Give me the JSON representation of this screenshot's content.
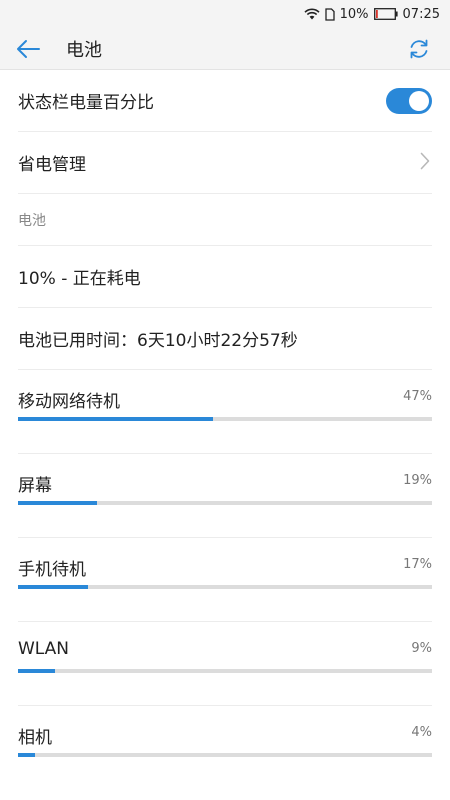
{
  "statusbar": {
    "battery_percent": "10%",
    "time": "07:25",
    "battery_level": 0.1
  },
  "appbar": {
    "title": "电池"
  },
  "settings": {
    "percent_toggle_label": "状态栏电量百分比",
    "percent_toggle_on": true,
    "power_saving_label": "省电管理",
    "battery_section_header": "电池",
    "battery_status": "10% - 正在耗电",
    "battery_usage_time": "电池已用时间：6天10小时22分57秒"
  },
  "usage": [
    {
      "name": "移动网络待机",
      "percent_label": "47%",
      "value": 47
    },
    {
      "name": "屏幕",
      "percent_label": "19%",
      "value": 19
    },
    {
      "name": "手机待机",
      "percent_label": "17%",
      "value": 17
    },
    {
      "name": "WLAN",
      "percent_label": "9%",
      "value": 9
    },
    {
      "name": "相机",
      "percent_label": "4%",
      "value": 4
    }
  ],
  "colors": {
    "accent": "#2a88d8",
    "track": "#dcdcdc"
  }
}
